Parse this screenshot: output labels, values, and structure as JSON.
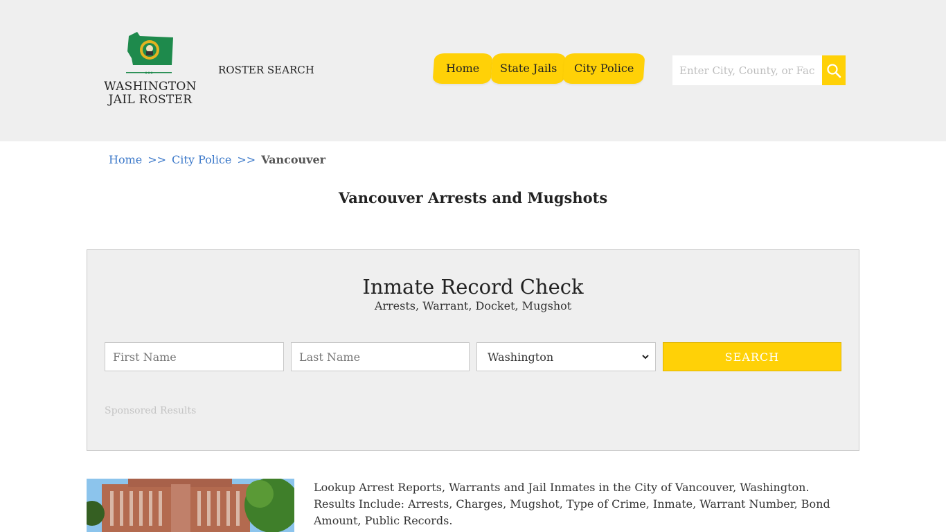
{
  "header": {
    "logo_line1": "WASHINGTON",
    "logo_line2": "JAIL ROSTER",
    "roster_search": "ROSTER SEARCH",
    "nav": [
      "Home",
      "State Jails",
      "City Police"
    ],
    "search_placeholder": "Enter City, County, or Facility",
    "accent": "#ffd107"
  },
  "breadcrumb": {
    "home": "Home",
    "sep": ">>",
    "city_police": "City Police",
    "current": "Vancouver"
  },
  "page_title": "Vancouver Arrests and Mugshots",
  "record_check": {
    "title": "Inmate Record Check",
    "subtitle": "Arrests, Warrant, Docket, Mugshot",
    "first_placeholder": "First Name",
    "last_placeholder": "Last Name",
    "state_selected": "Washington",
    "search_label": "SEARCH",
    "sponsored": "Sponsored Results"
  },
  "description": "Lookup Arrest Reports, Warrants and Jail Inmates in the City of Vancouver, Washington. Results Include: Arrests, Charges, Mugshot, Type of Crime, Inmate, Warrant Number, Bond Amount, Public Records."
}
